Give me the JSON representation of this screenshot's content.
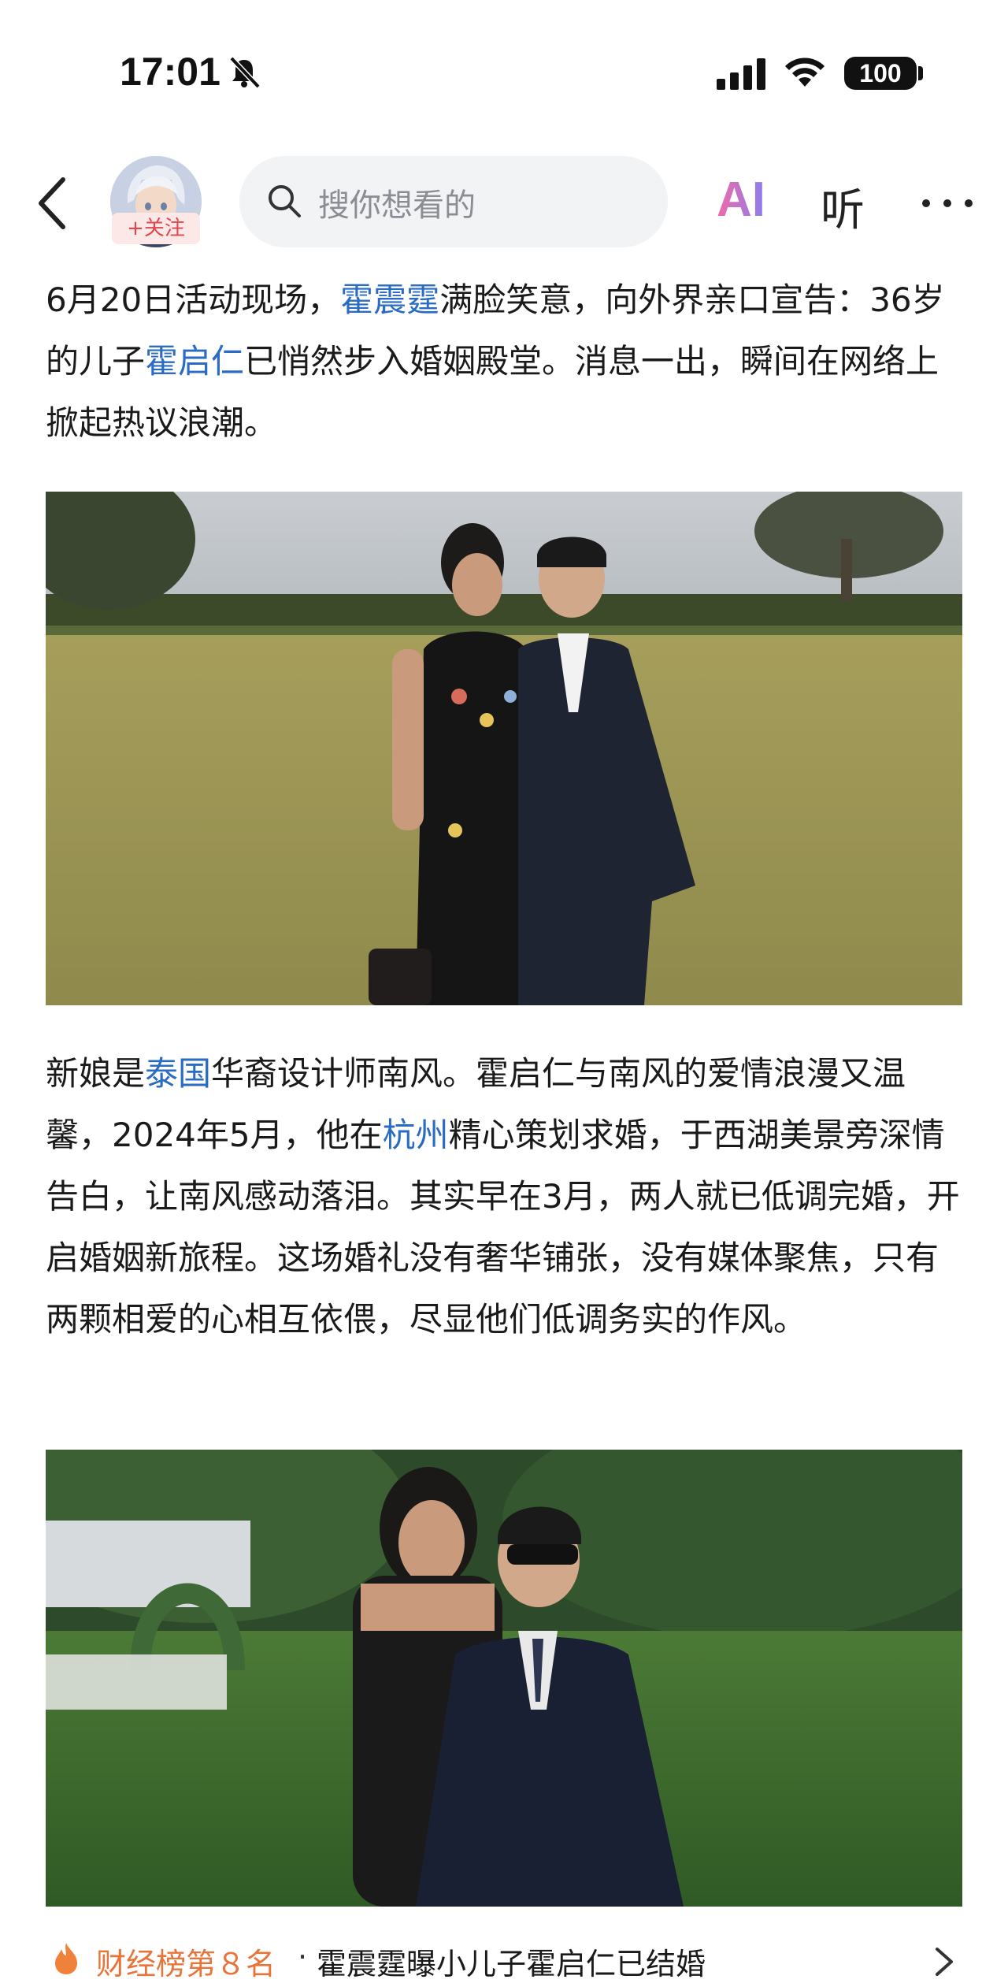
{
  "status_bar": {
    "time": "17:01",
    "battery": "100"
  },
  "nav": {
    "follow_label": "+关注",
    "search_placeholder": "搜你想看的",
    "ai_label": "AI",
    "listen_label": "听"
  },
  "article": {
    "para1": [
      {
        "text": "6月20日活动现场，",
        "link": false
      },
      {
        "text": "霍震霆",
        "link": true
      },
      {
        "text": "满脸笑意，向外界亲口宣告：36岁的儿子",
        "link": false
      },
      {
        "text": "霍启仁",
        "link": true
      },
      {
        "text": "已悄然步入婚姻殿堂。消息一出，瞬间在网络上掀起热议浪潮。",
        "link": false
      }
    ],
    "para2": [
      {
        "text": "新娘是",
        "link": false
      },
      {
        "text": "泰国",
        "link": true
      },
      {
        "text": "华裔设计师南风。霍启仁与南风的爱情浪漫又温馨，2024年5月，他在",
        "link": false
      },
      {
        "text": "杭州",
        "link": true
      },
      {
        "text": "精心策划求婚，于西湖美景旁深情告白，让南风感动落泪。其实早在3月，两人就已低调完婚，开启婚姻新旅程。这场婚礼没有奢华铺张，没有媒体聚焦，只有两颗相爱的心相互依偎，尽显他们低调务实的作风。",
        "link": false
      }
    ]
  },
  "bottom_bar": {
    "rank": "财经榜第８名",
    "separator": "·",
    "headline": "霍震霆曝小儿子霍启仁已结婚"
  },
  "colors": {
    "link": "#2a6bc4",
    "accent_orange": "#e8743a",
    "follow_red": "#e0464e"
  }
}
